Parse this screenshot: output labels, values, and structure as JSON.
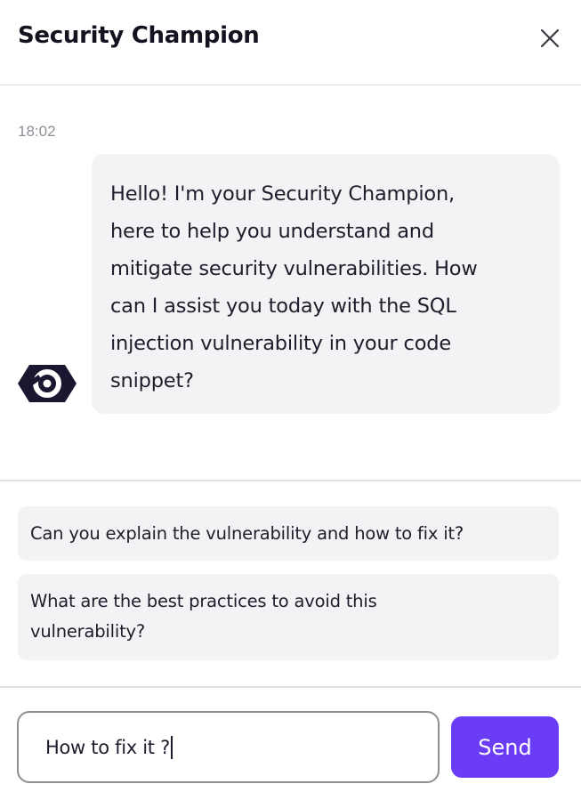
{
  "header": {
    "title": "Security Champion",
    "close_icon": "close-icon"
  },
  "chat": {
    "timestamp": "18:02",
    "assistant_avatar": "shield-logo-icon",
    "message_lines": [
      "Hello! I'm your Security Champion,",
      "here to help you understand and",
      "mitigate security vulnerabilities. How",
      "can I assist you today with the SQL",
      "injection vulnerability in your code",
      "snippet?"
    ]
  },
  "suggestions": [
    {
      "lines": [
        "Can you explain the vulnerability and how to fix it?"
      ]
    },
    {
      "lines": [
        "What are the best practices to avoid this",
        "vulnerability?"
      ]
    }
  ],
  "composer": {
    "input_value": "How to fix it ?",
    "send_label": "Send"
  },
  "colors": {
    "accent": "#6b3cf6",
    "bubble_bg": "#f3f3f5",
    "text": "#1f1d2b",
    "muted": "#8f8f98"
  }
}
